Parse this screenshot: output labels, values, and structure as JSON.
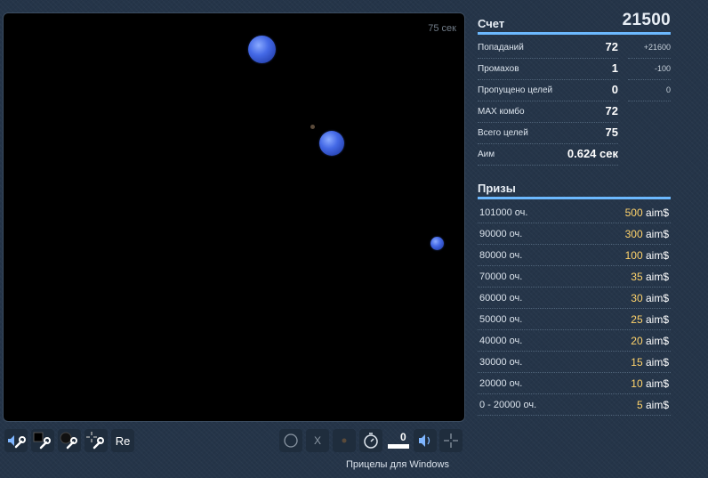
{
  "game": {
    "timer_text": "75 сек"
  },
  "score": {
    "label": "Счет",
    "value": "21500"
  },
  "stats": [
    {
      "name": "Попаданий",
      "value": "72",
      "extra": "+21600"
    },
    {
      "name": "Промахов",
      "value": "1",
      "extra": "-100"
    },
    {
      "name": "Пропущено целей",
      "value": "0",
      "extra": "0"
    },
    {
      "name": "MAX комбо",
      "value": "72",
      "extra": ""
    },
    {
      "name": "Всего целей",
      "value": "75",
      "extra": ""
    },
    {
      "name": "Аим",
      "value": "0.624 сек",
      "extra": ""
    }
  ],
  "prizes": {
    "title": "Призы",
    "currency": "aim$",
    "rows": [
      {
        "points": "101000 оч.",
        "amount": "500"
      },
      {
        "points": "90000 оч.",
        "amount": "300"
      },
      {
        "points": "80000 оч.",
        "amount": "100"
      },
      {
        "points": "70000 оч.",
        "amount": "35"
      },
      {
        "points": "60000 оч.",
        "amount": "30"
      },
      {
        "points": "50000 оч.",
        "amount": "25"
      },
      {
        "points": "40000 оч.",
        "amount": "20"
      },
      {
        "points": "30000 оч.",
        "amount": "15"
      },
      {
        "points": "20000 оч.",
        "amount": "10"
      },
      {
        "points": "0 - 20000 оч.",
        "amount": "5"
      }
    ]
  },
  "toolbar_left": {
    "restart_label": "Re"
  },
  "toolbar_right": {
    "close_target_label": "X",
    "slider_value": "0"
  },
  "footer": {
    "link_text": "Прицелы для Windows"
  },
  "colors": {
    "panel_accent": "#6cb9ff",
    "prize_amount": "#ffd36b",
    "target_blue": "#4469e6",
    "background": "#253549"
  }
}
